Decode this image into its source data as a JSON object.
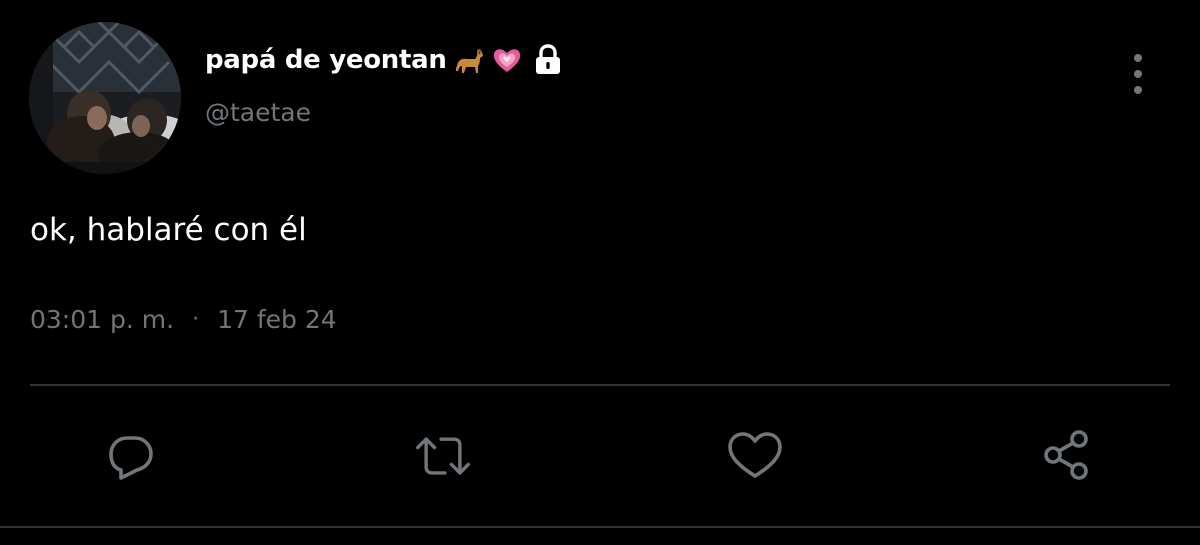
{
  "author": {
    "display_name": "papá de yeontan",
    "name_emojis": [
      "dog-emoji",
      "growing-heart-emoji"
    ],
    "protected_icon": "lock-icon",
    "handle": "@taetae",
    "avatar": "profile-photo"
  },
  "tweet": {
    "text": "ok, hablaré con él",
    "time": "03:01 p. m.",
    "separator": "·",
    "date": "17 feb 24"
  },
  "actions": [
    {
      "name": "reply",
      "icon": "reply-icon"
    },
    {
      "name": "retweet",
      "icon": "retweet-icon"
    },
    {
      "name": "like",
      "icon": "heart-icon"
    },
    {
      "name": "share",
      "icon": "share-icon"
    }
  ],
  "more_menu_icon": "more-vertical-icon",
  "colors": {
    "background": "#000000",
    "primary_text": "#ffffff",
    "secondary_text": "#71767b",
    "divider": "#2f3336",
    "heart_emoji": "#e75b9a"
  }
}
